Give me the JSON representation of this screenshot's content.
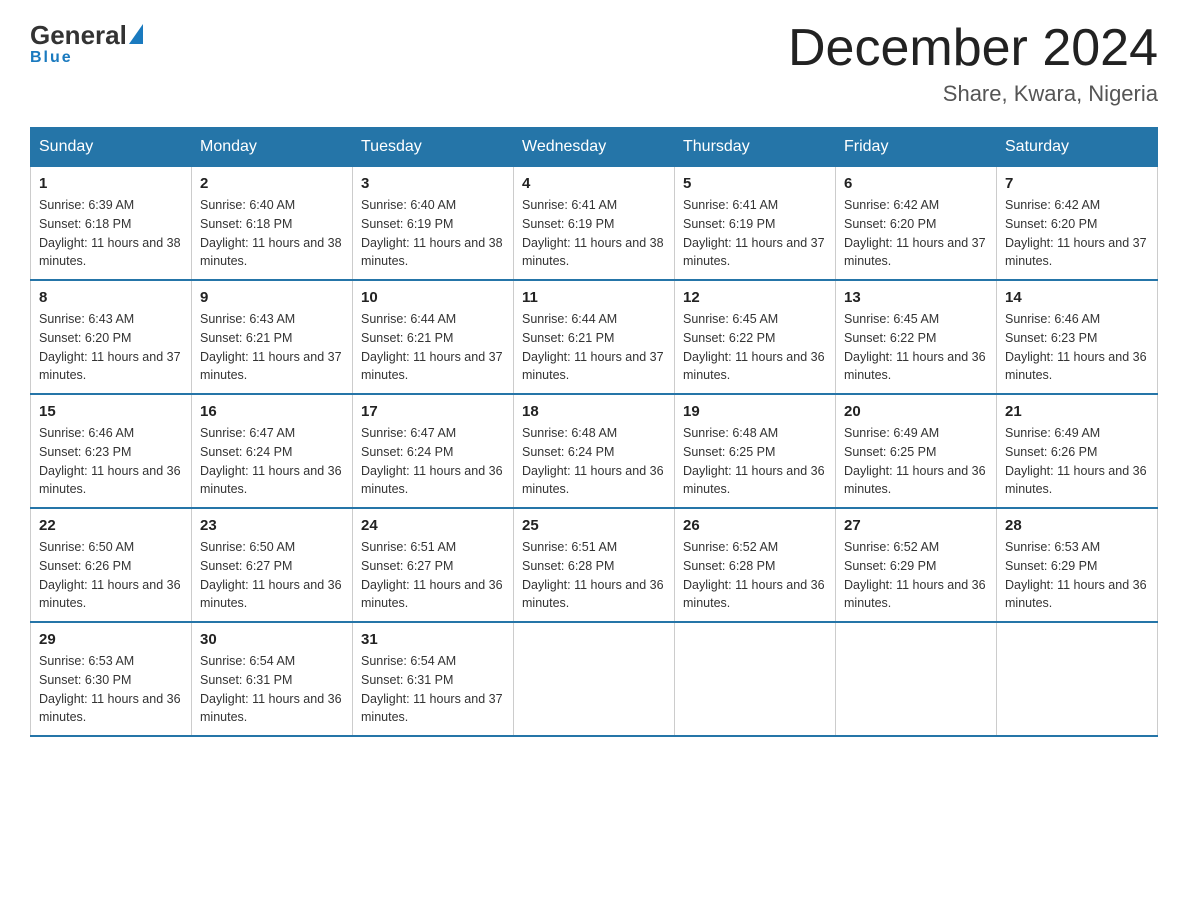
{
  "header": {
    "logo": {
      "general": "General",
      "blue": "Blue",
      "underline": "Blue"
    },
    "title": "December 2024",
    "location": "Share, Kwara, Nigeria"
  },
  "days_of_week": [
    "Sunday",
    "Monday",
    "Tuesday",
    "Wednesday",
    "Thursday",
    "Friday",
    "Saturday"
  ],
  "weeks": [
    [
      {
        "day": "1",
        "sunrise": "6:39 AM",
        "sunset": "6:18 PM",
        "daylight": "11 hours and 38 minutes."
      },
      {
        "day": "2",
        "sunrise": "6:40 AM",
        "sunset": "6:18 PM",
        "daylight": "11 hours and 38 minutes."
      },
      {
        "day": "3",
        "sunrise": "6:40 AM",
        "sunset": "6:19 PM",
        "daylight": "11 hours and 38 minutes."
      },
      {
        "day": "4",
        "sunrise": "6:41 AM",
        "sunset": "6:19 PM",
        "daylight": "11 hours and 38 minutes."
      },
      {
        "day": "5",
        "sunrise": "6:41 AM",
        "sunset": "6:19 PM",
        "daylight": "11 hours and 37 minutes."
      },
      {
        "day": "6",
        "sunrise": "6:42 AM",
        "sunset": "6:20 PM",
        "daylight": "11 hours and 37 minutes."
      },
      {
        "day": "7",
        "sunrise": "6:42 AM",
        "sunset": "6:20 PM",
        "daylight": "11 hours and 37 minutes."
      }
    ],
    [
      {
        "day": "8",
        "sunrise": "6:43 AM",
        "sunset": "6:20 PM",
        "daylight": "11 hours and 37 minutes."
      },
      {
        "day": "9",
        "sunrise": "6:43 AM",
        "sunset": "6:21 PM",
        "daylight": "11 hours and 37 minutes."
      },
      {
        "day": "10",
        "sunrise": "6:44 AM",
        "sunset": "6:21 PM",
        "daylight": "11 hours and 37 minutes."
      },
      {
        "day": "11",
        "sunrise": "6:44 AM",
        "sunset": "6:21 PM",
        "daylight": "11 hours and 37 minutes."
      },
      {
        "day": "12",
        "sunrise": "6:45 AM",
        "sunset": "6:22 PM",
        "daylight": "11 hours and 36 minutes."
      },
      {
        "day": "13",
        "sunrise": "6:45 AM",
        "sunset": "6:22 PM",
        "daylight": "11 hours and 36 minutes."
      },
      {
        "day": "14",
        "sunrise": "6:46 AM",
        "sunset": "6:23 PM",
        "daylight": "11 hours and 36 minutes."
      }
    ],
    [
      {
        "day": "15",
        "sunrise": "6:46 AM",
        "sunset": "6:23 PM",
        "daylight": "11 hours and 36 minutes."
      },
      {
        "day": "16",
        "sunrise": "6:47 AM",
        "sunset": "6:24 PM",
        "daylight": "11 hours and 36 minutes."
      },
      {
        "day": "17",
        "sunrise": "6:47 AM",
        "sunset": "6:24 PM",
        "daylight": "11 hours and 36 minutes."
      },
      {
        "day": "18",
        "sunrise": "6:48 AM",
        "sunset": "6:24 PM",
        "daylight": "11 hours and 36 minutes."
      },
      {
        "day": "19",
        "sunrise": "6:48 AM",
        "sunset": "6:25 PM",
        "daylight": "11 hours and 36 minutes."
      },
      {
        "day": "20",
        "sunrise": "6:49 AM",
        "sunset": "6:25 PM",
        "daylight": "11 hours and 36 minutes."
      },
      {
        "day": "21",
        "sunrise": "6:49 AM",
        "sunset": "6:26 PM",
        "daylight": "11 hours and 36 minutes."
      }
    ],
    [
      {
        "day": "22",
        "sunrise": "6:50 AM",
        "sunset": "6:26 PM",
        "daylight": "11 hours and 36 minutes."
      },
      {
        "day": "23",
        "sunrise": "6:50 AM",
        "sunset": "6:27 PM",
        "daylight": "11 hours and 36 minutes."
      },
      {
        "day": "24",
        "sunrise": "6:51 AM",
        "sunset": "6:27 PM",
        "daylight": "11 hours and 36 minutes."
      },
      {
        "day": "25",
        "sunrise": "6:51 AM",
        "sunset": "6:28 PM",
        "daylight": "11 hours and 36 minutes."
      },
      {
        "day": "26",
        "sunrise": "6:52 AM",
        "sunset": "6:28 PM",
        "daylight": "11 hours and 36 minutes."
      },
      {
        "day": "27",
        "sunrise": "6:52 AM",
        "sunset": "6:29 PM",
        "daylight": "11 hours and 36 minutes."
      },
      {
        "day": "28",
        "sunrise": "6:53 AM",
        "sunset": "6:29 PM",
        "daylight": "11 hours and 36 minutes."
      }
    ],
    [
      {
        "day": "29",
        "sunrise": "6:53 AM",
        "sunset": "6:30 PM",
        "daylight": "11 hours and 36 minutes."
      },
      {
        "day": "30",
        "sunrise": "6:54 AM",
        "sunset": "6:31 PM",
        "daylight": "11 hours and 36 minutes."
      },
      {
        "day": "31",
        "sunrise": "6:54 AM",
        "sunset": "6:31 PM",
        "daylight": "11 hours and 37 minutes."
      },
      null,
      null,
      null,
      null
    ]
  ]
}
